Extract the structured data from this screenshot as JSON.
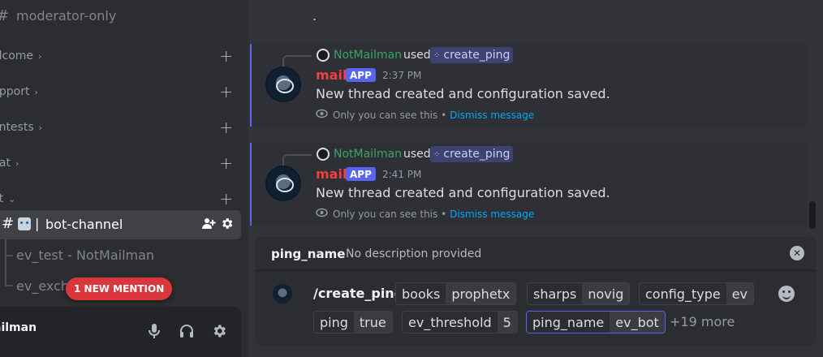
{
  "sidebar": {
    "moderator_channel": "moderator-only",
    "categories": [
      {
        "label": "elcome"
      },
      {
        "label": "upport"
      },
      {
        "label": "ontests"
      },
      {
        "label": "hat"
      },
      {
        "label": "ot"
      }
    ],
    "active_channel": "bot-channel",
    "threads": [
      {
        "label": "ev_test - NotMailman"
      },
      {
        "label": "ev_exch"
      }
    ],
    "mention_pill": "1 NEW MENTION",
    "user_panel": {
      "username": "ailman"
    }
  },
  "chat": {
    "top_fragment": ".",
    "messages": [
      {
        "used_by": "NotMailman",
        "used_word": "used",
        "command": "create_ping",
        "author": "mail",
        "tag": "APP",
        "time": "2:37 PM",
        "content": "New thread created and configuration saved.",
        "ephemeral_note": "Only you can see this •",
        "dismiss": "Dismiss message"
      },
      {
        "used_by": "NotMailman",
        "used_word": "used",
        "command": "create_ping",
        "author": "mail",
        "tag": "APP",
        "time": "2:41 PM",
        "content": "New thread created and configuration saved.",
        "ephemeral_note": "Only you can see this •",
        "dismiss": "Dismiss message"
      }
    ]
  },
  "autocomplete": {
    "param_name": "ping_name",
    "param_desc": "No description provided",
    "command": "/create_ping",
    "options": [
      {
        "key": "books",
        "value": "prophetx"
      },
      {
        "key": "sharps",
        "value": "novig"
      },
      {
        "key": "config_type",
        "value": "ev"
      },
      {
        "key": "ping",
        "value": "true"
      },
      {
        "key": "ev_threshold",
        "value": "5"
      },
      {
        "key": "ping_name",
        "value": "ev_bot"
      }
    ],
    "more": "+19 more"
  },
  "colors": {
    "accent": "#5865f2",
    "mention": "#da373c",
    "username_green": "#3ba55d",
    "author_red": "#f23f42",
    "link": "#00a8fc"
  },
  "icons": [
    "add-member-icon",
    "gear-icon",
    "mic-icon",
    "headphones-icon",
    "eye-icon",
    "close-icon",
    "emoji-icon",
    "plus-icon",
    "chevron-icon"
  ]
}
